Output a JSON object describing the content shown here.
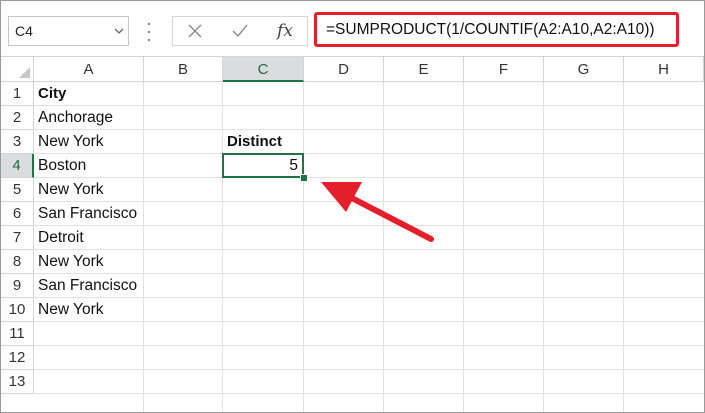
{
  "formula_bar": {
    "name_box": "C4",
    "cancel_icon": "x-icon",
    "enter_icon": "checkmark-icon",
    "fx_label": "fx",
    "formula": "=SUMPRODUCT(1/COUNTIF(A2:A10,A2:A10))"
  },
  "grid": {
    "columns": [
      "A",
      "B",
      "C",
      "D",
      "E",
      "F",
      "G",
      "H"
    ],
    "rows": [
      "1",
      "2",
      "3",
      "4",
      "5",
      "6",
      "7",
      "8",
      "9",
      "10",
      "11",
      "12",
      "13"
    ],
    "selected_column": "C",
    "selected_row": "4",
    "cells": {
      "A1": "City",
      "A2": "Anchorage",
      "A3": "New York",
      "A4": "Boston",
      "A5": "New York",
      "A6": "San Francisco",
      "A7": "Detroit",
      "A8": "New York",
      "A9": "San Francisco",
      "A10": "New York",
      "C3": "Distinct",
      "C4": "5"
    }
  },
  "annotation": {
    "highlight_color": "#e41e2b",
    "arrow_color": "#e41e2b"
  },
  "colors": {
    "selection_green": "#217346",
    "header_selected_bg": "#dadcdd"
  }
}
